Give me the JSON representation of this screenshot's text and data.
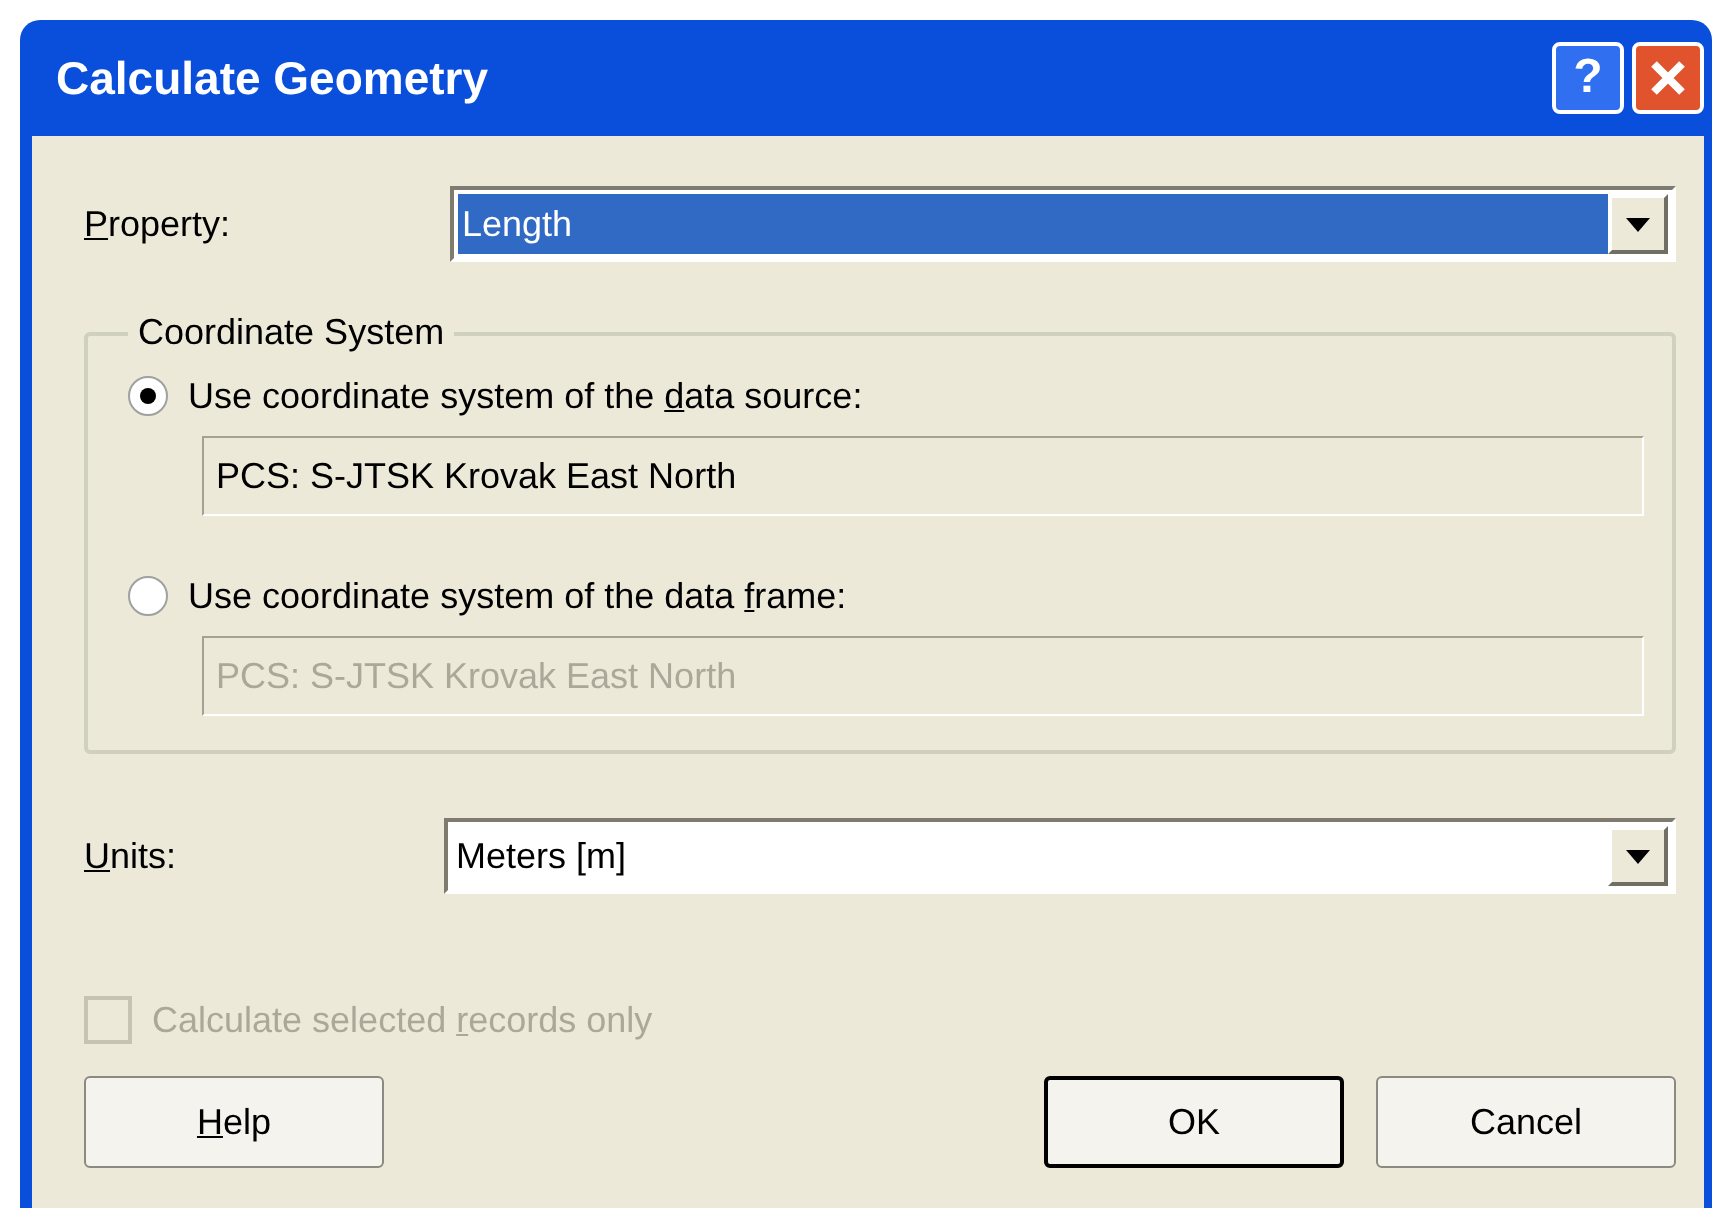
{
  "window": {
    "title": "Calculate Geometry",
    "title_buttons": [
      {
        "kind": "help",
        "label": "?"
      },
      {
        "kind": "close"
      }
    ]
  },
  "property": {
    "label": {
      "key": "P",
      "after": "roperty:"
    },
    "value": "Length",
    "focused": true
  },
  "coordinate_system": {
    "legend": "Coordinate System",
    "options": [
      {
        "label": {
          "before": "Use coordinate system of the ",
          "key": "d",
          "after": "ata source:"
        },
        "selected": true,
        "value": "PCS: S-JTSK Krovak East North"
      },
      {
        "label": {
          "before": "Use coordinate system of the data ",
          "key": "f",
          "after": "rame:"
        },
        "selected": false,
        "value": "PCS: S-JTSK Krovak East North"
      }
    ]
  },
  "units": {
    "label": {
      "key": "U",
      "after": "nits:"
    },
    "value": "Meters [m]",
    "focused": false
  },
  "selected_only": {
    "label": {
      "before": "Calculate selected ",
      "key": "r",
      "after": "ecords only"
    },
    "checked": false,
    "disabled": true
  },
  "buttons": [
    {
      "label": {
        "key": "H",
        "after": "elp"
      },
      "default": false,
      "kind": "help"
    },
    {
      "label": {
        "before": "OK"
      },
      "default": true,
      "kind": "command"
    },
    {
      "label": {
        "before": "Cancel"
      },
      "default": false,
      "kind": "command"
    }
  ]
}
